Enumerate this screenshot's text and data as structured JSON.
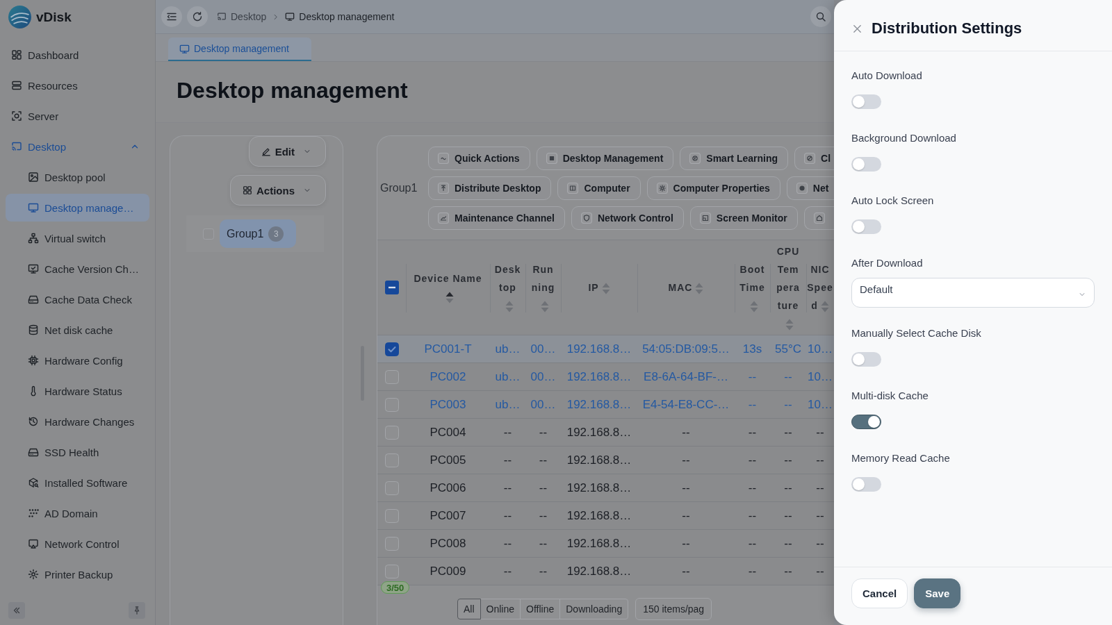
{
  "app": {
    "name": "vDisk"
  },
  "sidebar": {
    "items": [
      {
        "label": "Dashboard",
        "selected": false
      },
      {
        "label": "Resources",
        "selected": false
      },
      {
        "label": "Server",
        "selected": false
      },
      {
        "label": "Desktop",
        "selected": false,
        "expanded": true,
        "children": [
          {
            "label": "Desktop pool",
            "selected": false
          },
          {
            "label": "Desktop manage…",
            "selected": true
          },
          {
            "label": "Virtual switch",
            "selected": false
          },
          {
            "label": "Cache Version Ch…",
            "selected": false
          },
          {
            "label": "Cache Data Check",
            "selected": false
          },
          {
            "label": "Net disk cache",
            "selected": false
          },
          {
            "label": "Hardware Config",
            "selected": false
          },
          {
            "label": "Hardware Status",
            "selected": false
          },
          {
            "label": "Hardware Changes",
            "selected": false
          },
          {
            "label": "SSD Health",
            "selected": false
          },
          {
            "label": "Installed Software",
            "selected": false
          },
          {
            "label": "AD Domain",
            "selected": false
          },
          {
            "label": "Network Control",
            "selected": false
          },
          {
            "label": "Printer Backup",
            "selected": false
          }
        ]
      }
    ]
  },
  "topbar": {
    "breadcrumb": [
      "Desktop",
      "Desktop management"
    ]
  },
  "tabs": [
    {
      "label": "Desktop management",
      "selected": true
    }
  ],
  "page_title": "Desktop management",
  "group_panel": {
    "buttons": [
      {
        "label": "Edit"
      },
      {
        "label": "Actions"
      }
    ],
    "groups": [
      {
        "label": "Group1",
        "count": "3",
        "checked": false,
        "selected": true
      }
    ]
  },
  "toolbar": {
    "label": "Group1",
    "rows": [
      [
        {
          "kind": "text",
          "label": "Quick Actions"
        },
        {
          "kind": "text",
          "label": "Desktop Management"
        },
        {
          "kind": "text",
          "label": "Smart Learning"
        },
        {
          "kind": "text",
          "label": "Cl"
        }
      ],
      [
        {
          "kind": "text",
          "label": "Distribute Desktop"
        },
        {
          "kind": "text",
          "label": "Computer"
        },
        {
          "kind": "text",
          "label": "Computer Properties"
        },
        {
          "kind": "text",
          "label": "Net"
        }
      ],
      [
        {
          "kind": "text",
          "label": "Maintenance Channel"
        },
        {
          "kind": "text",
          "label": "Network Control"
        },
        {
          "kind": "text",
          "label": "Screen Monitor"
        },
        {
          "kind": "icon-only"
        }
      ]
    ]
  },
  "table": {
    "select_all": {
      "checked": false,
      "indeterminate": true
    },
    "columns": [
      {
        "label": "Device Name",
        "sorted": true
      },
      {
        "label": "Desktop",
        "sorted": false
      },
      {
        "label": "Running",
        "sorted": false
      },
      {
        "label": "IP",
        "sorted": false
      },
      {
        "label": "MAC",
        "sorted": false
      },
      {
        "label": "Boot Time",
        "sorted": false
      },
      {
        "label": "CPU Temperature",
        "sorted": false
      },
      {
        "label": "NIC Speed",
        "sorted": false
      }
    ],
    "rows": [
      {
        "selected": true,
        "online": true,
        "cells": [
          "PC001-T",
          "ub…",
          "00…",
          "192.168.8…",
          "54:05:DB:09:5…",
          "13s",
          "55°C",
          "10…"
        ]
      },
      {
        "selected": false,
        "online": true,
        "cells": [
          "PC002",
          "ub…",
          "00…",
          "192.168.8…",
          "E8-6A-64-BF-…",
          "--",
          "--",
          "10…"
        ]
      },
      {
        "selected": false,
        "online": true,
        "cells": [
          "PC003",
          "ub…",
          "00…",
          "192.168.8…",
          "E4-54-E8-CC-…",
          "--",
          "--",
          "10…"
        ]
      },
      {
        "selected": false,
        "online": false,
        "cells": [
          "PC004",
          "--",
          "--",
          "192.168.8…",
          "--",
          "--",
          "--",
          "--"
        ]
      },
      {
        "selected": false,
        "online": false,
        "cells": [
          "PC005",
          "--",
          "--",
          "192.168.8…",
          "--",
          "--",
          "--",
          "--"
        ]
      },
      {
        "selected": false,
        "online": false,
        "cells": [
          "PC006",
          "--",
          "--",
          "192.168.8…",
          "--",
          "--",
          "--",
          "--"
        ]
      },
      {
        "selected": false,
        "online": false,
        "cells": [
          "PC007",
          "--",
          "--",
          "192.168.8…",
          "--",
          "--",
          "--",
          "--"
        ]
      },
      {
        "selected": false,
        "online": false,
        "cells": [
          "PC008",
          "--",
          "--",
          "192.168.8…",
          "--",
          "--",
          "--",
          "--"
        ]
      },
      {
        "selected": false,
        "online": false,
        "cells": [
          "PC009",
          "--",
          "--",
          "192.168.8…",
          "--",
          "--",
          "--",
          "--"
        ]
      }
    ],
    "count_badge": "3/50",
    "status_filters": [
      {
        "label": "All",
        "selected": true
      },
      {
        "label": "Online",
        "selected": false
      },
      {
        "label": "Offline",
        "selected": false
      },
      {
        "label": "Downloading",
        "selected": false
      }
    ],
    "page_size": "150 items/pag"
  },
  "drawer": {
    "title": "Distribution Settings",
    "settings": [
      {
        "kind": "toggle",
        "label": "Auto Download",
        "on": false
      },
      {
        "kind": "toggle",
        "label": "Background Download",
        "on": false
      },
      {
        "kind": "toggle",
        "label": "Auto Lock Screen",
        "on": false
      },
      {
        "kind": "select",
        "label": "After Download",
        "value": "Default"
      },
      {
        "kind": "toggle",
        "label": "Manually Select Cache Disk",
        "on": false
      },
      {
        "kind": "toggle",
        "label": "Multi-disk Cache",
        "on": true
      },
      {
        "kind": "toggle",
        "label": "Memory Read Cache",
        "on": false
      }
    ],
    "buttons": [
      {
        "kind": "secondary",
        "label": "Cancel"
      },
      {
        "kind": "primary",
        "label": "Save"
      }
    ]
  }
}
